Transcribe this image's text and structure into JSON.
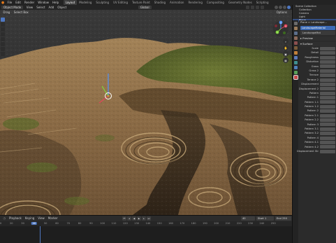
{
  "topbar": {
    "menus": [
      "File",
      "Edit",
      "Render",
      "Window",
      "Help"
    ],
    "workspaces": [
      "Layout",
      "Modeling",
      "Sculpting",
      "UV Editing",
      "Texture Paint",
      "Shading",
      "Animation",
      "Rendering",
      "Compositing",
      "Geometry Nodes",
      "Scripting"
    ],
    "active_workspace": "Layout"
  },
  "viewport": {
    "header": {
      "mode": "Object Mode",
      "menus": [
        "View",
        "Select",
        "Add",
        "Object"
      ],
      "orientation": "Global"
    },
    "header2": {
      "drag": "Drag",
      "select": "Select Box"
    },
    "options_label": "Options",
    "gizmo_axes": [
      "X",
      "Y",
      "Z"
    ]
  },
  "timeline": {
    "menus": [
      "Playback",
      "Keying",
      "View",
      "Marker"
    ],
    "current_frame": "40",
    "ticks": [
      "10",
      "20",
      "30",
      "40",
      "50",
      "60",
      "70",
      "80",
      "90",
      "100",
      "110",
      "120",
      "130",
      "140",
      "150",
      "160",
      "170",
      "180",
      "190",
      "200",
      "210",
      "220",
      "230",
      "240",
      "250"
    ],
    "start_label": "Start",
    "start_value": "1",
    "end_label": "End",
    "end_value": "250"
  },
  "outliner": {
    "rows": [
      "Scene Collection",
      "Collection",
      "Camera",
      "Light",
      "Plane"
    ],
    "selected_row": "Plane"
  },
  "properties": {
    "breadcrumb": [
      "Plane",
      ">",
      "Landscape..."
    ],
    "material_slot": "LandscapeMaterial",
    "material_name": "LandscapeMat",
    "sections": [
      "Preview",
      "Surface"
    ],
    "rows": [
      "Scale",
      "Detail",
      "Roughness",
      "Distortion",
      "Grass",
      "Grass 2",
      "Terrace",
      "Terrace 2",
      "Displacement",
      "Displacement 2",
      "Pattern",
      "Pattern 1",
      "Pattern 1.1",
      "Pattern 1.2",
      "Pattern 2",
      "Pattern 2.1",
      "Pattern 2.2",
      "Pattern 3",
      "Pattern 3.1",
      "Pattern 3.2",
      "Pattern 4",
      "Pattern 4.1",
      "Pattern 4.2",
      "Displacement Str"
    ]
  },
  "colors": {
    "accent": "#4f78c2",
    "selection": "#3c6ab5",
    "panel": "#2b2b2b"
  }
}
